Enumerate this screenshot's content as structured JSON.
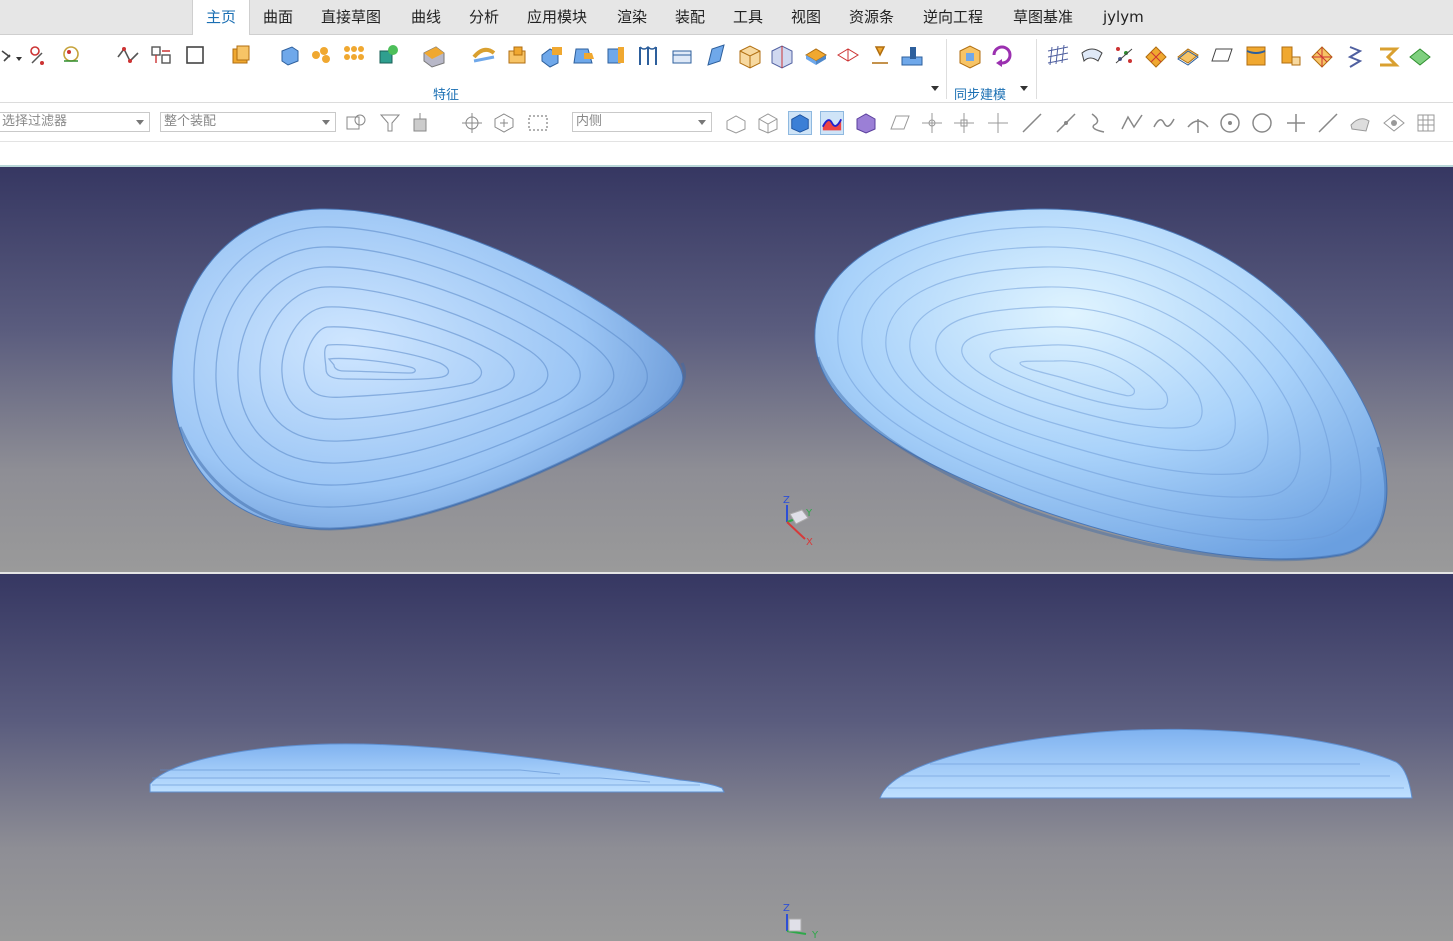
{
  "menu": {
    "tabs": [
      {
        "label": "主页",
        "active": true
      },
      {
        "label": "曲面"
      },
      {
        "label": "直接草图"
      },
      {
        "label": "曲线"
      },
      {
        "label": "分析"
      },
      {
        "label": "应用模块"
      },
      {
        "label": "渲染"
      },
      {
        "label": "装配"
      },
      {
        "label": "工具"
      },
      {
        "label": "视图"
      },
      {
        "label": "资源条"
      },
      {
        "label": "逆向工程"
      },
      {
        "label": "草图基准"
      },
      {
        "label": "jylym"
      }
    ]
  },
  "ribbon": {
    "group_feature_label": "特征",
    "group_sync_label": "同步建模"
  },
  "filterbar": {
    "selection_filter": "选择过滤器",
    "assembly_scope": "整个装配",
    "selection_mode": "内侧"
  },
  "colors": {
    "accent": "#1a6fb3",
    "model_blue": "#8fbff3",
    "viewport_top": "#363762",
    "viewport_bottom": "#9a9a9a"
  },
  "triad": {
    "x_label": "X",
    "y_label": "Y",
    "z_label": "Z"
  }
}
